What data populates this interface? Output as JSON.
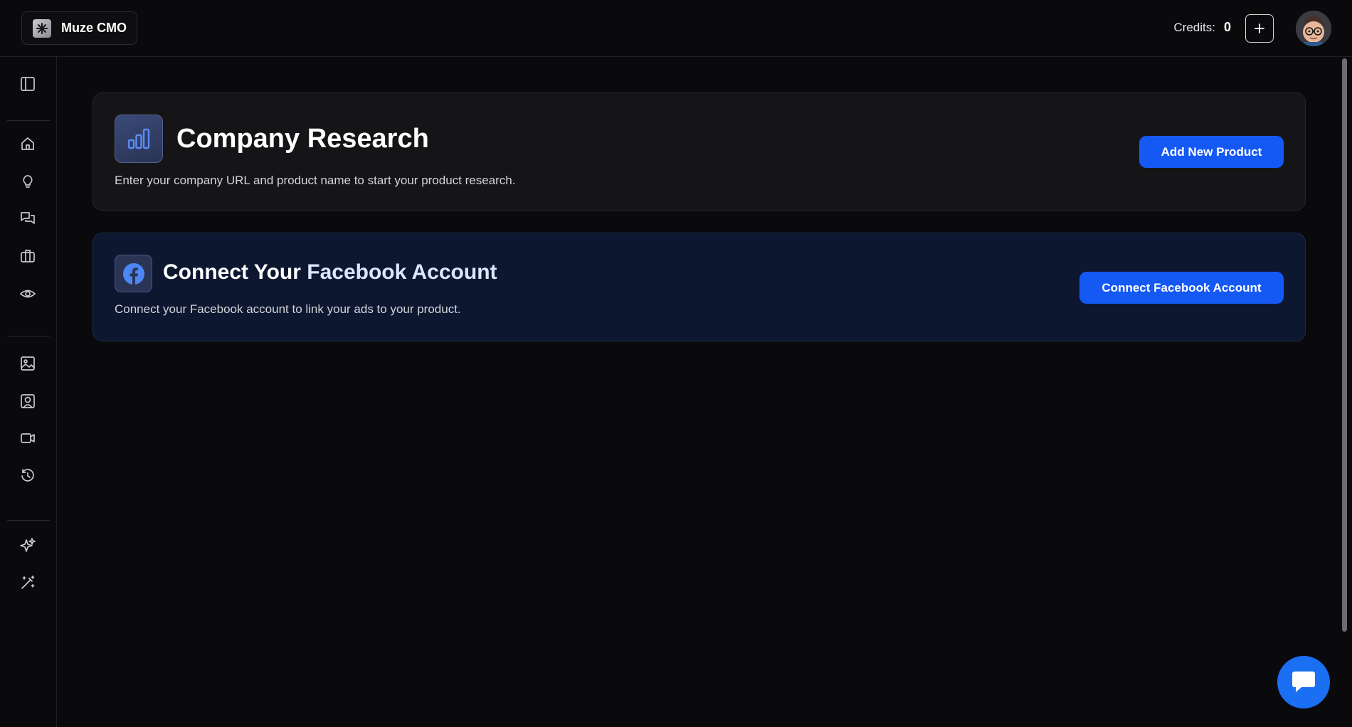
{
  "header": {
    "brand_name": "Muze CMO",
    "credits_label": "Credits:",
    "credits_value": "0"
  },
  "sidebar": {
    "items": [
      {
        "icon": "sidebar-toggle-icon"
      },
      {
        "icon": "home-icon"
      },
      {
        "icon": "lightbulb-icon"
      },
      {
        "icon": "chat-icon"
      },
      {
        "icon": "briefcase-icon"
      },
      {
        "icon": "eye-icon"
      },
      {
        "icon": "image-icon"
      },
      {
        "icon": "user-portrait-icon"
      },
      {
        "icon": "video-icon"
      },
      {
        "icon": "history-icon"
      },
      {
        "icon": "sparkle-icon"
      },
      {
        "icon": "magic-wand-icon"
      }
    ]
  },
  "research": {
    "title": "Company Research",
    "subtitle": "Enter your company URL and product name to start your product research.",
    "button_label": "Add New Product"
  },
  "facebook": {
    "title_prefix": "Connect Your ",
    "title_accent": "Facebook Account",
    "subtitle": "Connect your Facebook account to link your ads to your product.",
    "button_label": "Connect Facebook Account"
  },
  "colors": {
    "background": "#0a0a0c",
    "accent_blue": "#1559f5",
    "chat_blue": "#1a6ff2",
    "fb_card_bg": "#0d1730"
  }
}
